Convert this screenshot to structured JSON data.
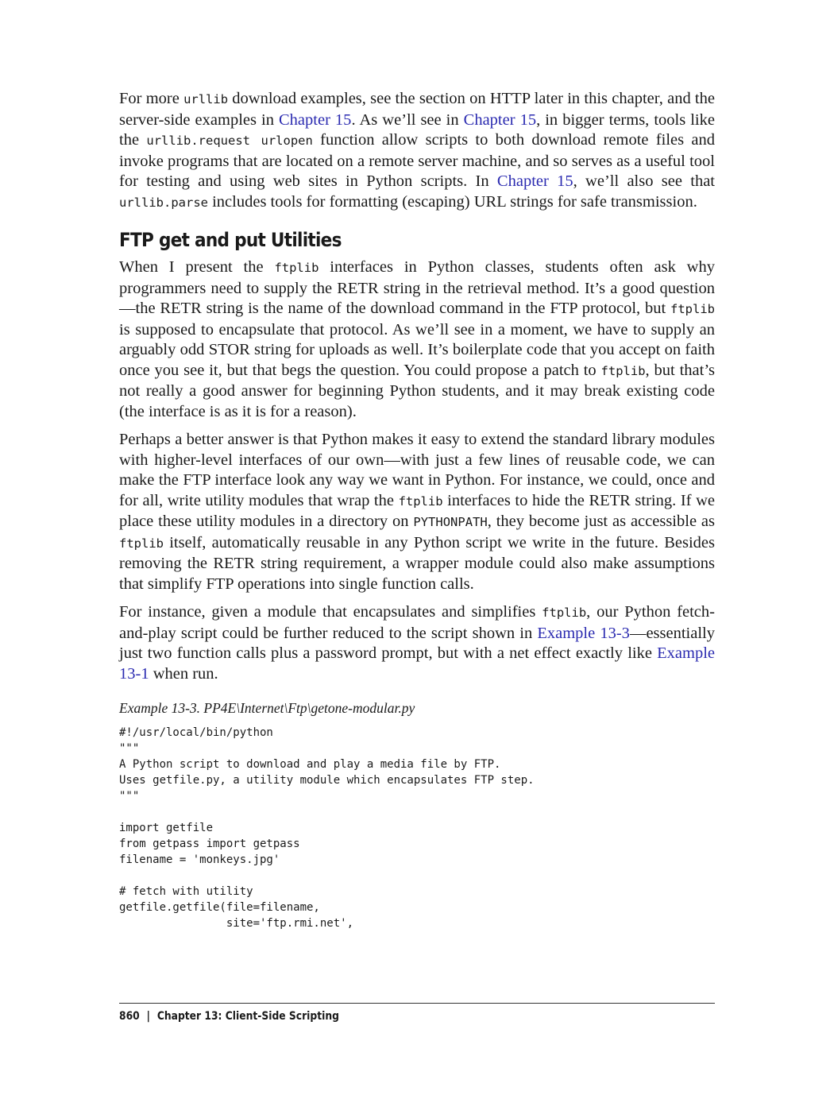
{
  "intro": {
    "t1": "For more ",
    "c1": "urllib",
    "t2": " download examples, see the section on HTTP later in this chapter, and the server-side examples in ",
    "link1": "Chapter 15",
    "t3": ". As we’ll see in ",
    "link2": "Chapter 15",
    "t4": ", in bigger terms, tools like the ",
    "c2": "urllib.request urlopen",
    "t5": " function allow scripts to both download remote files and invoke programs that are located on a remote server machine, and so serves as a useful tool for testing and using web sites in Python scripts. In ",
    "link3": "Chapter 15",
    "t6": ", we’ll also see that ",
    "c3": "urllib.parse",
    "t7": " includes tools for formatting (escaping) URL strings for safe transmission."
  },
  "section": {
    "title": "FTP get and put Utilities"
  },
  "p1": {
    "t1": "When I present the ",
    "c1": "ftplib",
    "t2": " interfaces in Python classes, students often ask why programmers need to supply the RETR string in the retrieval method. It’s a good question—the RETR string is the name of the download command in the FTP protocol, but ",
    "c2": "ftplib",
    "t3": " is supposed to encapsulate that protocol. As we’ll see in a moment, we have to supply an arguably odd STOR string for uploads as well. It’s boilerplate code that you accept on faith once you see it, but that begs the question. You could propose a patch to ",
    "c3": "ftplib",
    "t4": ", but that’s not really a good answer for beginning Python students, and it may break existing code (the interface is as it is for a reason)."
  },
  "p2": {
    "t1": "Perhaps a better answer is that Python makes it easy to extend the standard library modules with higher-level interfaces of our own—with just a few lines of reusable code, we can make the FTP interface look any way we want in Python. For instance, we could, once and for all, write utility modules that wrap the ",
    "c1": "ftplib",
    "t2": " interfaces to hide the RETR string. If we place these utility modules in a directory on ",
    "c2": "PYTHONPATH",
    "t3": ", they become just as accessible as ",
    "c3": "ftplib",
    "t4": " itself, automatically reusable in any Python script we write in the future. Besides removing the RETR string requirement, a wrapper module could also make assumptions that simplify FTP operations into single function calls."
  },
  "p3": {
    "t1": "For instance, given a module that encapsulates and simplifies ",
    "c1": "ftplib",
    "t2": ", our Python fetch-and-play script could be further reduced to the script shown in ",
    "link1": "Example 13-3",
    "t3": "—essentially just two function calls plus a password prompt, but with a net effect exactly like ",
    "link2": "Example 13-1",
    "t4": " when run."
  },
  "example": {
    "caption": "Example 13-3. PP4E\\Internet\\Ftp\\getone-modular.py",
    "code": "#!/usr/local/bin/python\n\"\"\"\nA Python script to download and play a media file by FTP.\nUses getfile.py, a utility module which encapsulates FTP step.\n\"\"\"\n\nimport getfile\nfrom getpass import getpass\nfilename = 'monkeys.jpg'\n\n# fetch with utility\ngetfile.getfile(file=filename,\n                site='ftp.rmi.net',"
  },
  "footer": {
    "page_number": "860",
    "separator": "|",
    "chapter": "Chapter 13:  Client-Side Scripting"
  }
}
